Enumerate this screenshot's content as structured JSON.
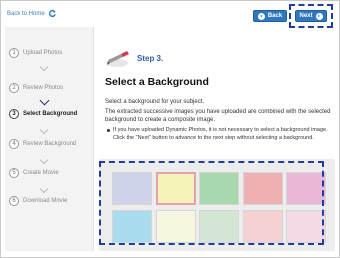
{
  "topbar": {
    "back_home_label": "Back to Home",
    "back_label": "Back",
    "next_label": "Next"
  },
  "sidebar": {
    "items": [
      {
        "num": "1",
        "label": "Upload Photos",
        "active": false
      },
      {
        "num": "2",
        "label": "Review Photos",
        "active": false
      },
      {
        "num": "3",
        "label": "Select Background",
        "active": true
      },
      {
        "num": "4",
        "label": "Review Background",
        "active": false
      },
      {
        "num": "5",
        "label": "Create Movie",
        "active": false
      },
      {
        "num": "6",
        "label": "Download Movie",
        "active": false
      }
    ]
  },
  "main": {
    "step_label": "Step 3.",
    "title": "Select a Background",
    "intro": "Select a background for your subject.",
    "description": "The extracted successive images you have uploaded are combined with the selected background to create a composite image.",
    "note": "If you have uploaded Dynamic Photos, it is not necessary to select a background image. Click the \"Next\" button to advance to the next step without selecting a background."
  },
  "backgrounds": {
    "selected_index": 1,
    "colors": [
      "#cfd3ea",
      "#f6f3b9",
      "#a8d8ae",
      "#efb0b4",
      "#eab8d6",
      "#a9dcef",
      "#f7f6de",
      "#d3e6d4",
      "#f6d1d2",
      "#f4d9e7"
    ]
  },
  "colors": {
    "accent": "#2f78c0",
    "annotation": "#1f3f9e",
    "step_blue": "#2a5fa8"
  }
}
